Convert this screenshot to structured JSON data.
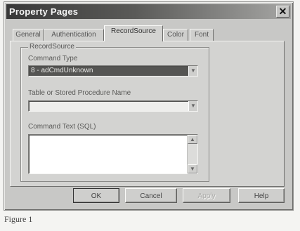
{
  "window": {
    "title": "Property Pages",
    "close_glyph": "✕"
  },
  "tabs": [
    {
      "label": "General"
    },
    {
      "label": "Authentication"
    },
    {
      "label": "RecordSource"
    },
    {
      "label": "Color"
    },
    {
      "label": "Font"
    }
  ],
  "active_tab": "RecordSource",
  "recordsource": {
    "group_label": "RecordSource",
    "command_type_label": "Command Type",
    "command_type_value": "8 - adCmdUnknown",
    "table_label": "Table or Stored Procedure Name",
    "table_value": "",
    "command_text_label": "Command Text (SQL)",
    "command_text_value": ""
  },
  "buttons": {
    "ok": "OK",
    "cancel": "Cancel",
    "apply": "Apply",
    "help": "Help"
  },
  "caption": "Figure 1"
}
